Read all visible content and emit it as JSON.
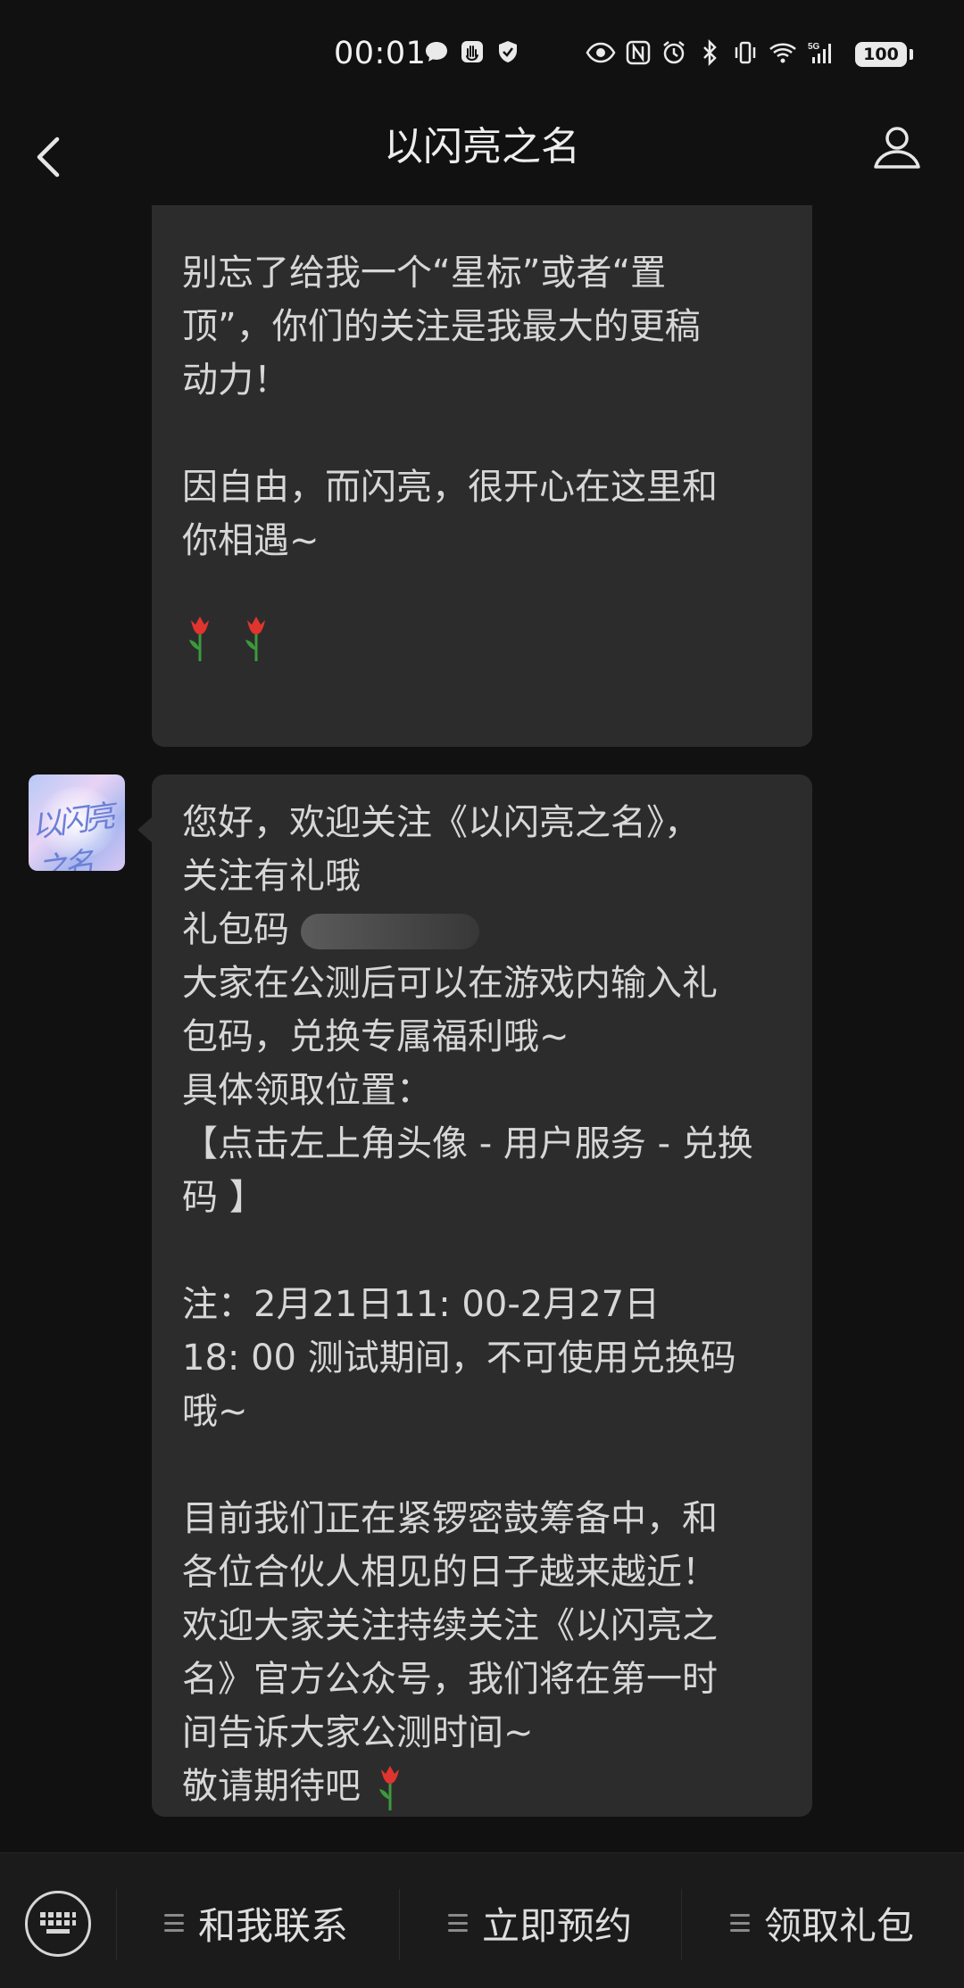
{
  "status_bar": {
    "time": "00:01",
    "left_icons": [
      "chat-bubble-icon",
      "hand-icon",
      "shield-check-icon"
    ],
    "right_icons": [
      "eye-icon",
      "nfc-icon",
      "alarm-icon",
      "bluetooth-icon",
      "vibrate-icon",
      "wifi-icon",
      "signal-5g-icon"
    ],
    "battery": "100"
  },
  "nav": {
    "title": "以闪亮之名",
    "back_icon": "chevron-left-icon",
    "profile_icon": "person-icon"
  },
  "messages": [
    {
      "lines": [
        "别忘了给我一个“星标”或者“置",
        "顶”，你们的关注是我最大的更稿",
        "动力！",
        "",
        "因自由，而闪亮，很开心在这里和",
        "你相遇~"
      ],
      "emoji": [
        "tulip-icon",
        "tulip-icon"
      ]
    },
    {
      "lines": [
        "您好，欢迎关注《以闪亮之名》，",
        "关注有礼哦",
        "礼包码",
        "大家在公测后可以在游戏内输入礼",
        "包码，兑换专属福利哦~",
        "具体领取位置：",
        "【点击左上角头像 - 用户服务 - 兑换",
        "码 】",
        "",
        "注：2月21日11: 00-2月27日",
        "18: 00 测试期间，不可使用兑换码",
        "哦~",
        "",
        "目前我们正在紧锣密鼓筹备中，和",
        "各位合伙人相见的日子越来越近！",
        "欢迎大家关注持续关注《以闪亮之",
        "名》官方公众号，我们将在第一时",
        "间告诉大家公测时间~",
        "敬请期待吧"
      ],
      "end_emoji": "tulip-icon"
    }
  ],
  "avatar": {
    "logo_text": "以闪亮之名"
  },
  "menu": {
    "keyboard_icon": "keyboard-icon",
    "items": [
      "和我联系",
      "立即预约",
      "领取礼包"
    ]
  },
  "colors": {
    "background": "#111111",
    "bubble": "#2c2c2c",
    "text": "#d7d7d7",
    "menu_bar": "#1b1b1b"
  }
}
